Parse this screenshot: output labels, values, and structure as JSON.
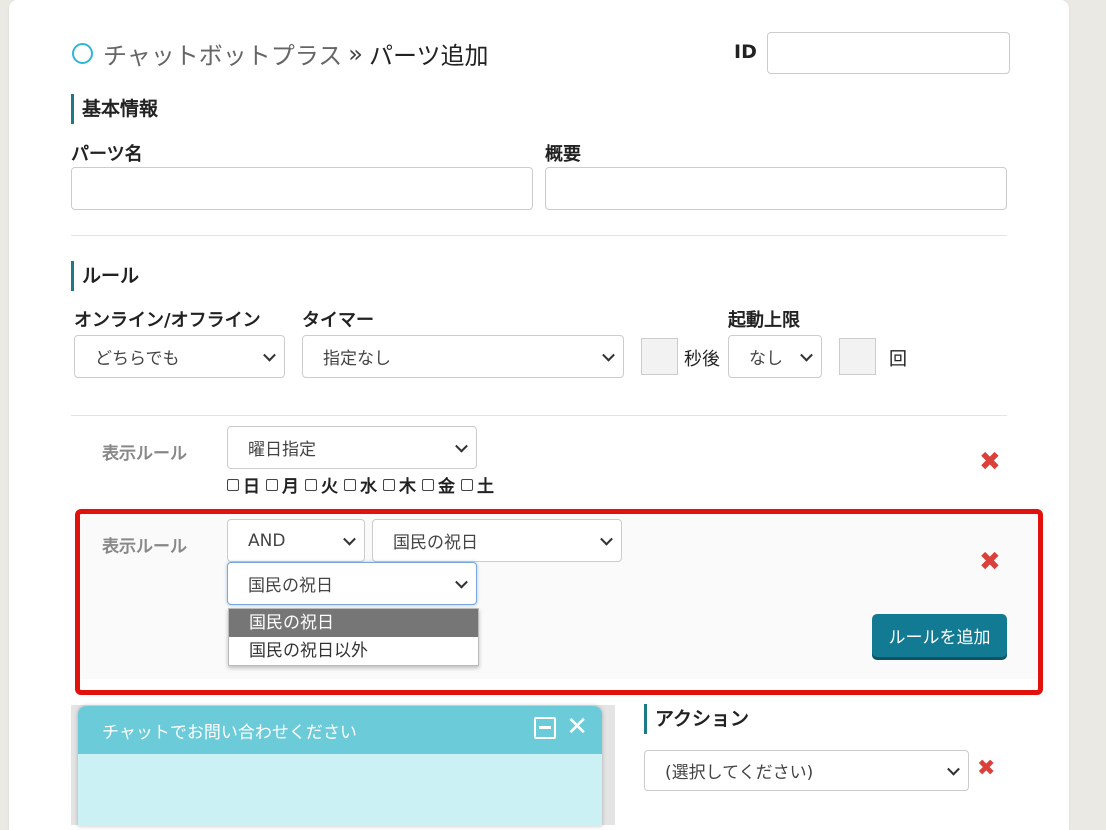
{
  "header": {
    "app_name": "チャットボットプラス",
    "separator": "»",
    "page_title": "パーツ追加",
    "id_label": "ID",
    "id_value": ""
  },
  "basic": {
    "heading": "基本情報",
    "part_name_label": "パーツ名",
    "part_name_value": "",
    "summary_label": "概要",
    "summary_value": ""
  },
  "rules": {
    "heading": "ルール",
    "online_label": "オンライン/オフライン",
    "online_value": "どちらでも",
    "timer_label": "タイマー",
    "timer_value": "指定なし",
    "seconds_after": "秒後",
    "limit_label": "起動上限",
    "limit_value": "なし",
    "times_unit": "回"
  },
  "display_rule_1": {
    "label": "表示ルール",
    "type_value": "曜日指定",
    "days": [
      "日",
      "月",
      "火",
      "水",
      "木",
      "金",
      "土"
    ]
  },
  "display_rule_2": {
    "label": "表示ルール",
    "operator_value": "AND",
    "type_value": "国民の祝日",
    "holiday_value": "国民の祝日",
    "dropdown_options": [
      "国民の祝日",
      "国民の祝日以外"
    ],
    "add_rule_button": "ルールを追加"
  },
  "chat": {
    "header_text": "チャットでお問い合わせください"
  },
  "action": {
    "heading": "アクション",
    "select_value": "(選択してください)"
  },
  "colors": {
    "accent": "#137a93",
    "highlight": "#e2110c",
    "delete": "#d9413a",
    "chat_header": "#6ccbd9"
  }
}
